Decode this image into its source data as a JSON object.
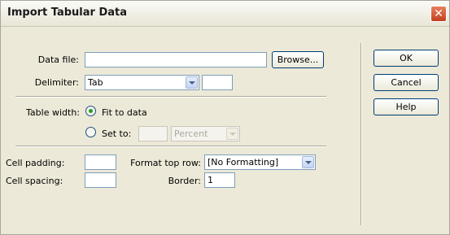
{
  "window": {
    "title": "Import Tabular Data",
    "close_glyph": "✕"
  },
  "data_file": {
    "label": "Data file:",
    "value": "",
    "browse_label": "Browse..."
  },
  "delimiter": {
    "label": "Delimiter:",
    "selected": "Tab",
    "other_value": ""
  },
  "table_width": {
    "label": "Table width:",
    "fit_label": "Fit to data",
    "fit_checked": true,
    "set_label": "Set to:",
    "set_checked": false,
    "set_value": "",
    "unit_selected": "Percent"
  },
  "cell_padding": {
    "label": "Cell padding:",
    "value": ""
  },
  "cell_spacing": {
    "label": "Cell spacing:",
    "value": ""
  },
  "format_top_row": {
    "label": "Format top row:",
    "selected": "[No Formatting]"
  },
  "border": {
    "label": "Border:",
    "value": "1"
  },
  "buttons": {
    "ok": "OK",
    "cancel": "Cancel",
    "help": "Help"
  },
  "icons": {
    "dropdown": "chevron-down-icon",
    "close": "close-icon"
  }
}
